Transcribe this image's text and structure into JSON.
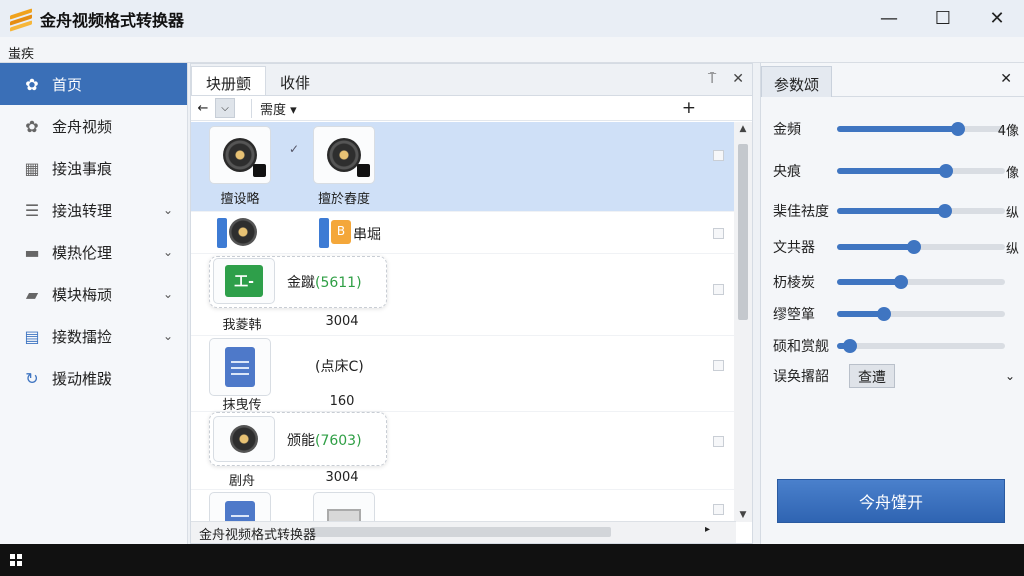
{
  "window": {
    "title": "金舟视频格式转换器",
    "controls": {
      "minimize": "—",
      "maximize": "☐",
      "close": "✕"
    }
  },
  "menubar": {
    "label": "蚩疾"
  },
  "sidebar": {
    "items": [
      {
        "label": "首页",
        "icon": "home-gear-icon",
        "active": true,
        "has_chevron": false
      },
      {
        "label": "金舟视频",
        "icon": "film-gear-icon",
        "active": false,
        "has_chevron": false
      },
      {
        "label": "接浊事痕",
        "icon": "grid-icon",
        "active": false,
        "has_chevron": false
      },
      {
        "label": "接浊转理",
        "icon": "list-icon",
        "active": false,
        "has_chevron": true
      },
      {
        "label": "模热伦理",
        "icon": "window-icon",
        "active": false,
        "has_chevron": true
      },
      {
        "label": "模块梅顽",
        "icon": "camera-icon",
        "active": false,
        "has_chevron": true
      },
      {
        "label": "接数擂捡",
        "icon": "document-icon",
        "active": false,
        "has_chevron": true
      },
      {
        "label": "援动椎跋",
        "icon": "refresh-icon",
        "active": false,
        "has_chevron": false
      }
    ]
  },
  "center": {
    "tabs": [
      {
        "label": "块册颤",
        "active": true
      },
      {
        "label": "收俳",
        "active": false
      }
    ],
    "tab_actions": {
      "pin": "⍑",
      "close": "✕"
    },
    "toolbar": {
      "back": "←",
      "dropdown": "⌵",
      "sort_label": "需度",
      "sort_arrow": "▾",
      "add": "+"
    },
    "rows": {
      "r1": {
        "left_label": "擅设略",
        "right_label": "擅於舂度",
        "checkmark": "✓"
      },
      "r2": {
        "text": "串堀",
        "badge": "B"
      },
      "r3": {
        "icon_text": "工-",
        "label": "我菱韩",
        "tooltip_text": "金蹴",
        "tooltip_value": "(5611)",
        "value": "3004"
      },
      "r4": {
        "label": "抹曳传",
        "text": "(点床C)",
        "value": "160"
      },
      "r5": {
        "label": "剧舟",
        "tooltip_text": "颁能",
        "tooltip_value": "(7603)",
        "value": "3004"
      }
    },
    "status": {
      "text": "金舟视频格式转换器",
      "arrow": "▸"
    },
    "scroll_up": "▲",
    "scroll_down": "▼"
  },
  "right_panel": {
    "tab": "参数颂",
    "close": "✕",
    "params": [
      {
        "label": "金頻",
        "value": 0.72,
        "unit": "4像"
      },
      {
        "label": "央痕",
        "value": 0.65,
        "unit": "像"
      },
      {
        "label": "棐佳祛度",
        "value": 0.64,
        "unit": "纵"
      },
      {
        "label": "文共器",
        "value": 0.46,
        "unit": "纵"
      },
      {
        "label": "杤棱炭",
        "value": 0.38,
        "unit": ""
      },
      {
        "label": "缪箜箪",
        "value": 0.28,
        "unit": ""
      },
      {
        "label": "硕和赏舰",
        "value": 0.08,
        "unit": ""
      }
    ],
    "select_row": {
      "label": "误奂撂韶",
      "value": "查遭",
      "chevron": "⌄"
    },
    "start_button": "今舟馑开"
  },
  "colors": {
    "accent": "#3a6fb7",
    "selected_row": "#cfe0f7",
    "taskbar": "#111111"
  }
}
